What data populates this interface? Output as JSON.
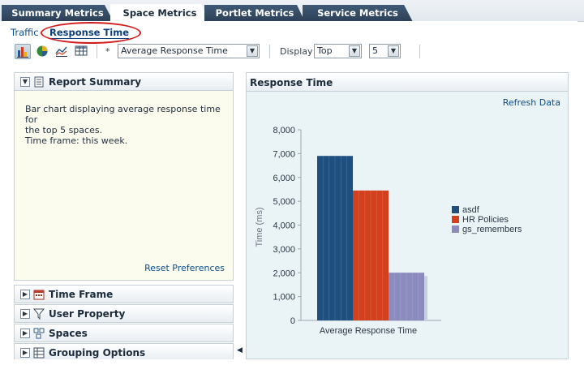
{
  "tabs": [
    {
      "label": "Summary Metrics",
      "active": false
    },
    {
      "label": "Space Metrics",
      "active": true
    },
    {
      "label": "Portlet Metrics",
      "active": false
    },
    {
      "label": "Service Metrics",
      "active": false
    }
  ],
  "subtabs": [
    {
      "label": "Traffic",
      "selected": false
    },
    {
      "label": "Response Time",
      "selected": true
    }
  ],
  "toolbar": {
    "chart_type_buttons": [
      "bar-chart-icon",
      "pie-chart-icon",
      "line-chart-icon",
      "table-icon"
    ],
    "required_marker": "*",
    "metric_value": "Average Response Time",
    "display_label": "Display",
    "display_value": "Top",
    "count_value": "5"
  },
  "left_panel": {
    "report_summary": {
      "title": "Report Summary",
      "line1": "Bar chart displaying average response time for",
      "line2": "the top 5 spaces.",
      "line3": "Time frame: this week.",
      "reset_link": "Reset Preferences"
    },
    "sections": [
      {
        "title": "Time Frame",
        "icon": "calendar-icon"
      },
      {
        "title": "User Property",
        "icon": "funnel-icon"
      },
      {
        "title": "Spaces",
        "icon": "spaces-icon"
      },
      {
        "title": "Grouping Options",
        "icon": "grouping-icon"
      }
    ]
  },
  "right_panel": {
    "title": "Response Time",
    "refresh_link": "Refresh Data"
  },
  "chart_data": {
    "type": "bar",
    "categories": [
      "Average Response Time"
    ],
    "series": [
      {
        "name": "asdf",
        "values": [
          6900
        ],
        "color": "#1f4f7e"
      },
      {
        "name": "HR Policies",
        "values": [
          5450
        ],
        "color": "#d2401d"
      },
      {
        "name": "gs_remembers",
        "values": [
          2000
        ],
        "color": "#8b8bbf"
      }
    ],
    "xlabel": "Average Response Time",
    "ylabel": "Time (ms)",
    "ylim": [
      0,
      8000
    ],
    "yticks": [
      "0",
      "1,000",
      "2,000",
      "3,000",
      "4,000",
      "5,000",
      "6,000",
      "7,000",
      "8,000"
    ],
    "grid": false,
    "legend": "right"
  }
}
